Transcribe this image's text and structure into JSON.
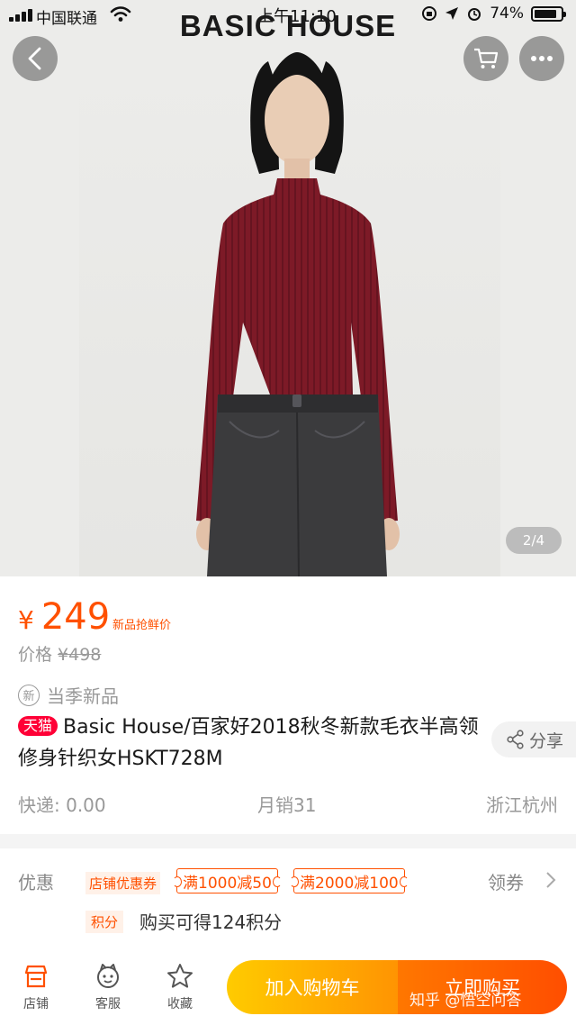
{
  "status_bar": {
    "carrier": "中国联通",
    "time": "上午11:10",
    "battery": "74%",
    "battery_level": 0.74
  },
  "brand": {
    "logo_text": "BASIC HOUSE"
  },
  "gallery": {
    "page_indicator": "2/4"
  },
  "price": {
    "currency": "¥",
    "value": "249",
    "tag": "新品抢鲜价",
    "original_label": "价格",
    "original_value": "¥498"
  },
  "season": {
    "badge": "新",
    "label": "当季新品"
  },
  "product": {
    "platform_badge": "天猫",
    "title": "Basic House/百家好2018秋冬新款毛衣半高领修身针织女HSKT728M",
    "share_label": "分享"
  },
  "meta": {
    "shipping": "快递: 0.00",
    "monthly_sales": "月销31",
    "location": "浙江杭州"
  },
  "promotions": {
    "label": "优惠",
    "shop_coupon": "店铺优惠券",
    "coupons": [
      "满1000减50",
      "满2000减100"
    ],
    "claim": "领券",
    "points_badge": "积分",
    "points_text": "购买可得124积分"
  },
  "bottom_bar": {
    "nav": [
      "店铺",
      "客服",
      "收藏"
    ],
    "add_to_cart": "加入购物车",
    "buy_now": "立即购买"
  },
  "watermark": {
    "text": "知乎 @悟空问答"
  },
  "colors": {
    "accent": "#ff5000",
    "tmall_red": "#ff0036",
    "cart_gradient": [
      "#ffcb00",
      "#ff9402"
    ],
    "buy_gradient": [
      "#ff7700",
      "#ff4e00"
    ],
    "sweater": "#7d1a27",
    "jeans": "#3b3b3d"
  }
}
